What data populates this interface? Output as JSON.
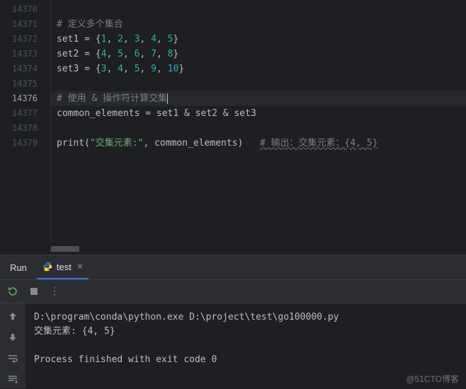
{
  "gutter": {
    "lines": [
      "14370",
      "14371",
      "14372",
      "14373",
      "14374",
      "14375",
      "14376",
      "14377",
      "14378",
      "14379"
    ],
    "active_index": 6
  },
  "code": {
    "l1_comment": "# 定义多个集合",
    "l2": {
      "var": "set1",
      "eq": " = ",
      "open": "{",
      "n1": "1",
      "c": ", ",
      "n2": "2",
      "n3": "3",
      "n4": "4",
      "n5": "5",
      "close": "}"
    },
    "l3": {
      "var": "set2",
      "eq": " = ",
      "open": "{",
      "n1": "4",
      "c": ", ",
      "n2": "5",
      "n3": "6",
      "n4": "7",
      "n5": "8",
      "close": "}"
    },
    "l4": {
      "var": "set3",
      "eq": " = ",
      "open": "{",
      "n1": "3",
      "c": ", ",
      "n2": "4",
      "n3": "5",
      "n4": "9",
      "n5": "10",
      "close": "}"
    },
    "l6_comment": "# 使用 & 操作符计算交集",
    "l7": {
      "var": "common_elements",
      "eq": " = ",
      "expr": "set1 & set2 & set3"
    },
    "l9": {
      "fn": "print",
      "open": "(",
      "str": "\"交集元素:\"",
      "c": ", ",
      "arg": "common_elements",
      "close": ")",
      "sp": "   ",
      "comment": "# 输出：交集元素：{4, 5}"
    }
  },
  "run": {
    "label": "Run",
    "tab_name": "test",
    "console_line1": "D:\\program\\conda\\python.exe D:\\project\\test\\go100000.py",
    "console_line2": "交集元素: {4, 5}",
    "console_line3": "",
    "console_line4": "Process finished with exit code 0"
  },
  "watermark": "@51CTO博客"
}
